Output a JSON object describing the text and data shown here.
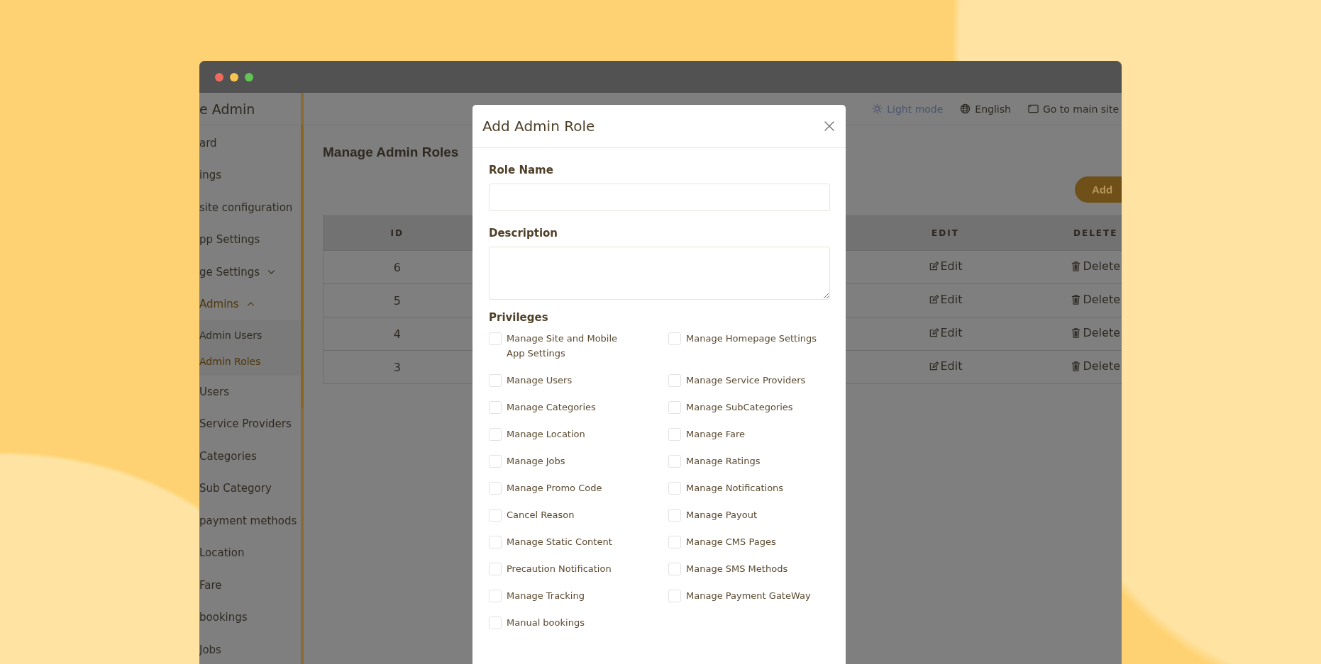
{
  "window": {
    "controls": [
      {
        "color": "#ee6a5f"
      },
      {
        "color": "#f5c451"
      },
      {
        "color": "#61c454"
      }
    ]
  },
  "sidebar": {
    "title": "e Admin",
    "items": [
      {
        "label": "ard",
        "selected": false
      },
      {
        "label": "ings",
        "selected": false
      },
      {
        "label": "site configuration",
        "selected": false
      },
      {
        "label": "pp Settings",
        "selected": false
      },
      {
        "label": "ge Settings",
        "selected": false,
        "expanded": false
      },
      {
        "label": "Admins",
        "selected": true,
        "expanded": true,
        "children": [
          {
            "label": "Admin Users",
            "selected": false
          },
          {
            "label": "Admin Roles",
            "selected": true
          }
        ]
      },
      {
        "label": "Users",
        "selected": false
      },
      {
        "label": "Service Providers",
        "selected": false
      },
      {
        "label": "Categories",
        "selected": false
      },
      {
        "label": "Sub Category",
        "selected": false
      },
      {
        "label": "payment methods",
        "selected": false
      },
      {
        "label": "Location",
        "selected": false
      },
      {
        "label": "Fare",
        "selected": false
      },
      {
        "label": "bookings",
        "selected": false
      },
      {
        "label": "Jobs",
        "selected": false
      }
    ]
  },
  "header": {
    "links": [
      {
        "kind": "theme",
        "label": "Light mode"
      },
      {
        "kind": "language",
        "label": "English"
      },
      {
        "kind": "site",
        "label": "Go to main site"
      }
    ]
  },
  "page": {
    "title": "Manage Admin Roles",
    "add_button": "Add"
  },
  "table": {
    "columns": [
      "ID",
      "EDIT",
      "DELETE"
    ],
    "rows": [
      {
        "id": "6",
        "edit": "Edit",
        "delete": "Delete"
      },
      {
        "id": "5",
        "edit": "Edit",
        "delete": "Delete"
      },
      {
        "id": "4",
        "edit": "Edit",
        "delete": "Delete"
      },
      {
        "id": "3",
        "edit": "Edit",
        "delete": "Delete"
      }
    ]
  },
  "dialog": {
    "title": "Add Admin Role",
    "fields": [
      {
        "kind": "input",
        "label": "Role Name"
      },
      {
        "kind": "textarea",
        "label": "Description"
      }
    ],
    "privileges_label": "Privileges",
    "privileges": [
      {
        "label": "Manage Site and Mobile App Settings",
        "checked": false
      },
      {
        "label": "Manage Homepage Settings",
        "checked": false
      },
      {
        "label": "Manage Users",
        "checked": false
      },
      {
        "label": "Manage Service Providers",
        "checked": false
      },
      {
        "label": "Manage Categories",
        "checked": false
      },
      {
        "label": "Manage SubCategories",
        "checked": false
      },
      {
        "label": "Manage Location",
        "checked": false
      },
      {
        "label": "Manage Fare",
        "checked": false
      },
      {
        "label": "Manage Jobs",
        "checked": false
      },
      {
        "label": "Manage Ratings",
        "checked": false
      },
      {
        "label": "Manage Promo Code",
        "checked": false
      },
      {
        "label": "Manage Notifications",
        "checked": false
      },
      {
        "label": "Cancel Reason",
        "checked": false
      },
      {
        "label": "Manage Payout",
        "checked": false
      },
      {
        "label": "Manage Static Content",
        "checked": false
      },
      {
        "label": "Manage CMS Pages",
        "checked": false
      },
      {
        "label": "Precaution Notification",
        "checked": false
      },
      {
        "label": "Manage SMS Methods",
        "checked": false
      },
      {
        "label": "Manage Tracking",
        "checked": false
      },
      {
        "label": "Manage Payment GateWay",
        "checked": false
      },
      {
        "label": "Manual bookings",
        "checked": false
      }
    ]
  }
}
